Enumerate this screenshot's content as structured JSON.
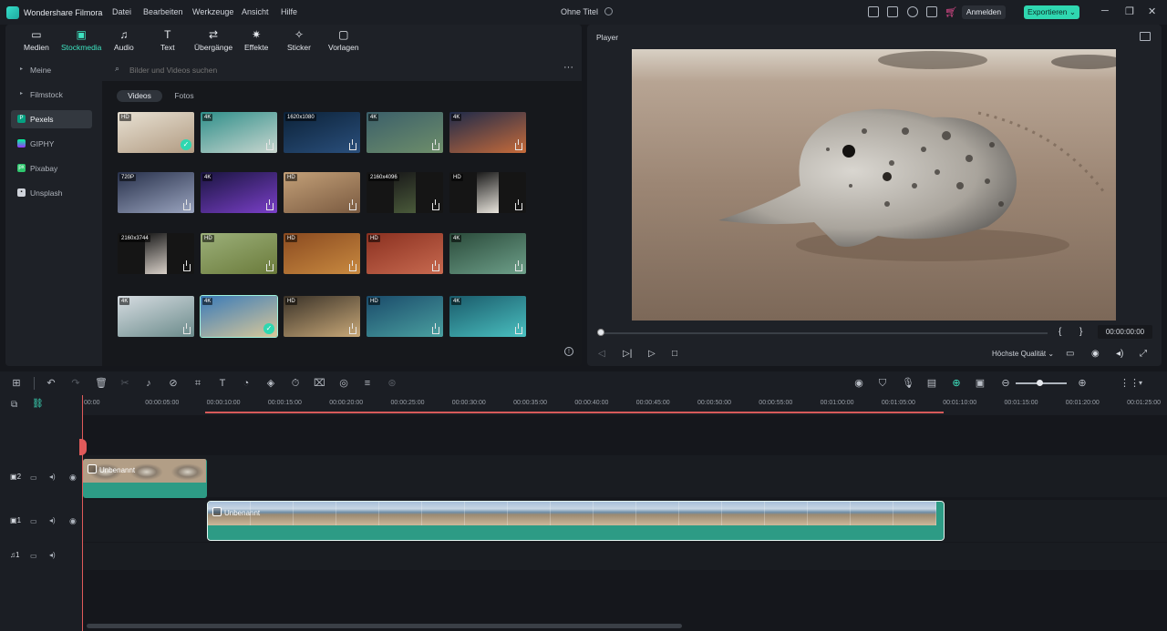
{
  "titlebar": {
    "app_name": "Wondershare Filmora",
    "menu": [
      "Datei",
      "Bearbeiten",
      "Werkzeuge",
      "Ansicht",
      "Hilfe"
    ],
    "doc_title": "Ohne Titel",
    "login": "Anmelden",
    "export": "Exportieren"
  },
  "toolbar": {
    "tools": [
      "Medien",
      "Stockmedia",
      "Audio",
      "Text",
      "Übergänge",
      "Effekte",
      "Sticker",
      "Vorlagen"
    ]
  },
  "sidenav": {
    "items": [
      "Meine",
      "Filmstock",
      "Pexels",
      "GIPHY",
      "Pixabay",
      "Unsplash"
    ]
  },
  "search": {
    "placeholder": "Bilder und Videos suchen"
  },
  "filters": {
    "videos": "Videos",
    "photos": "Fotos"
  },
  "thumbs": {
    "badges": [
      [
        "HD",
        "4K",
        "1620x1080",
        "4K",
        "4K"
      ],
      [
        "720P",
        "4K",
        "HD",
        "2160x4096",
        "HD"
      ],
      [
        "2160x3744",
        "HD",
        "HD",
        "HD",
        "4K"
      ],
      [
        "4K",
        "4K",
        "HD",
        "HD",
        "4K"
      ]
    ]
  },
  "player": {
    "title": "Player",
    "timecode": "00:00:00:00",
    "quality": "Höchste Qualität"
  },
  "timeline": {
    "ruler": [
      "00:00",
      "00:00:05:00",
      "00:00:10:00",
      "00:00:15:00",
      "00:00:20:00",
      "00:00:25:00",
      "00:00:30:00",
      "00:00:35:00",
      "00:00:40:00",
      "00:00:45:00",
      "00:00:50:00",
      "00:00:55:00",
      "00:01:00:00",
      "00:01:05:00",
      "00:01:10:00",
      "00:01:15:00",
      "00:01:20:00",
      "00:01:25:00"
    ],
    "tracks": [
      "2",
      "1",
      "1"
    ],
    "clip_label": "Unbenannt"
  },
  "colors": {
    "accent": "#2fd7b0",
    "clip": "#2d9b85",
    "playhead": "#e05a5a"
  }
}
